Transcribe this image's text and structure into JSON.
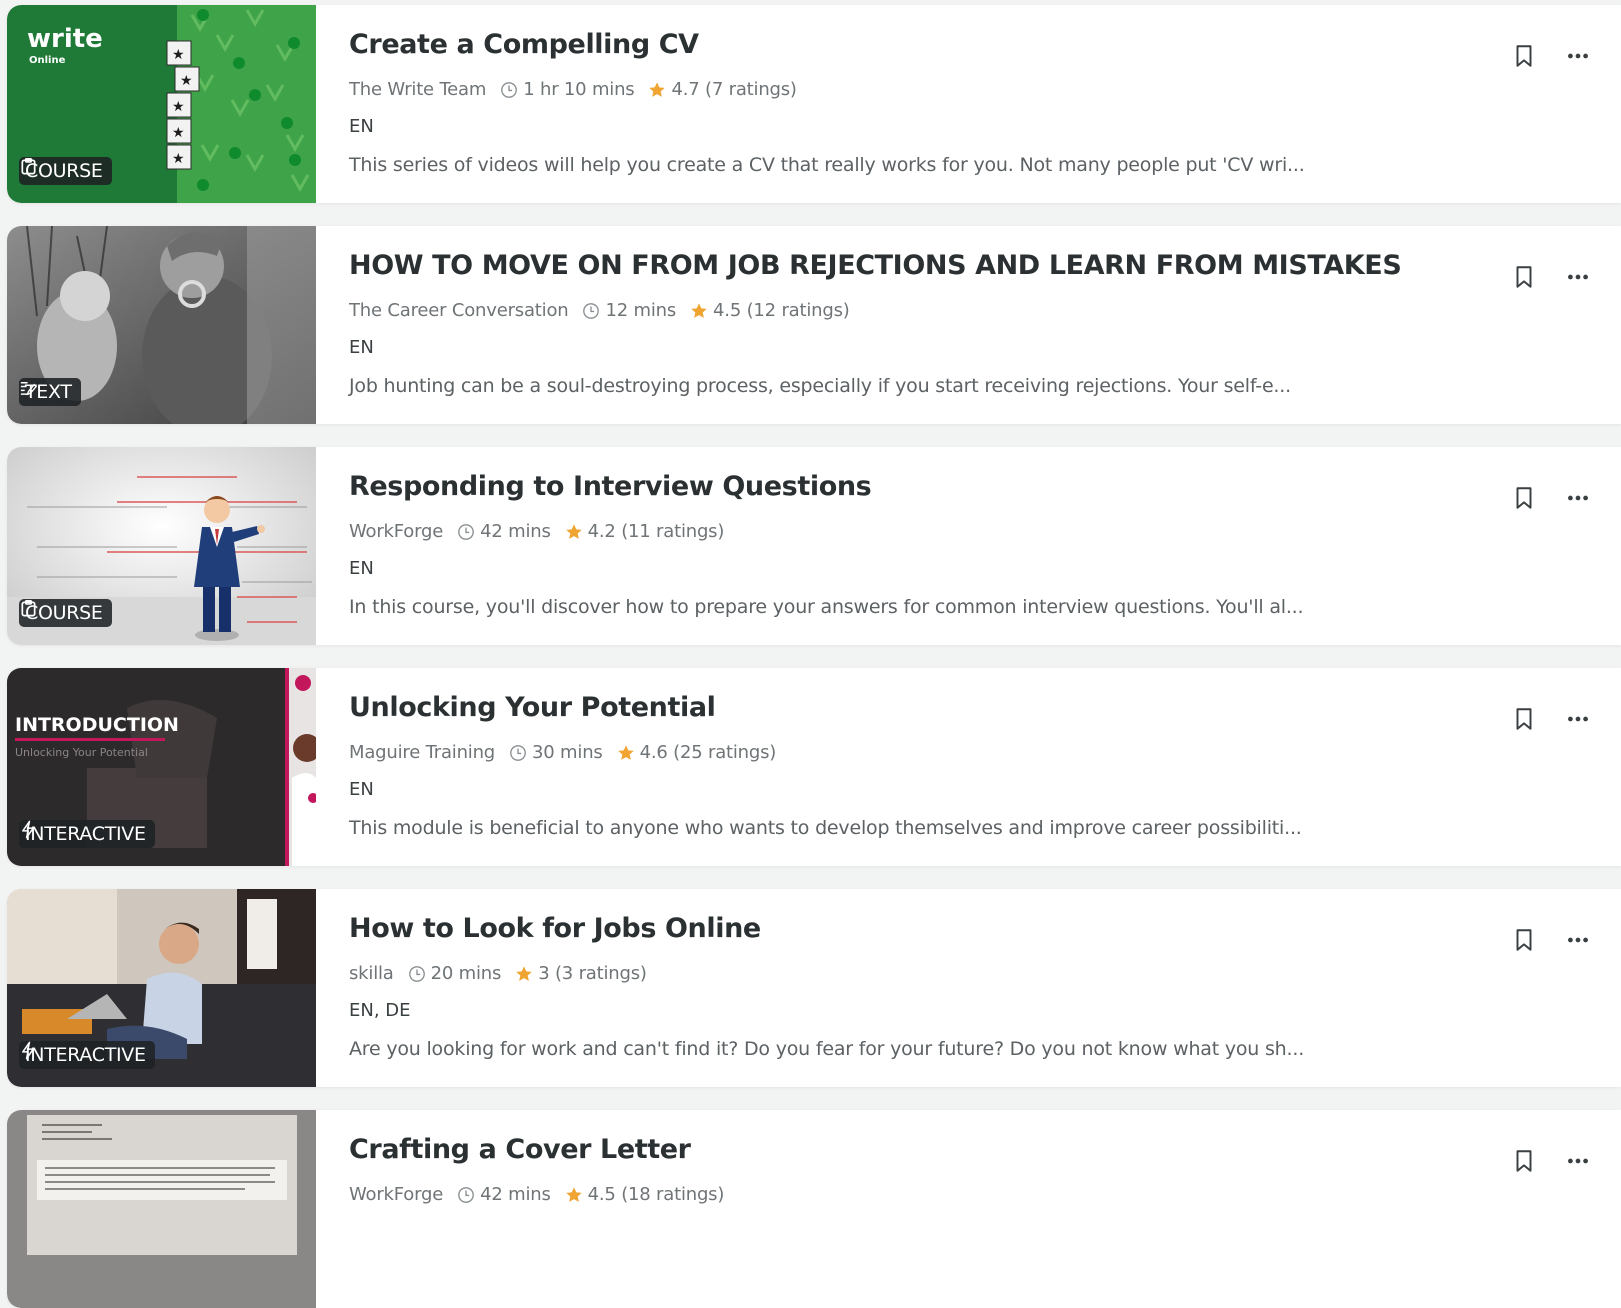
{
  "items": [
    {
      "title": "Create a Compelling CV",
      "provider": "The Write Team",
      "duration": "1 hr 10 mins",
      "rating": "4.7 (7 ratings)",
      "languages": "EN",
      "description": "This series of videos will help you create a CV that really works for you. Not many people put 'CV wri...",
      "type": "COURSE",
      "thumb_logo_main": "write",
      "thumb_logo_sub": "Online"
    },
    {
      "title": "HOW TO MOVE ON FROM JOB REJECTIONS AND LEARN FROM MISTAKES",
      "provider": "The Career Conversation",
      "duration": "12 mins",
      "rating": "4.5 (12 ratings)",
      "languages": "EN",
      "description": "Job hunting can be a soul-destroying process, especially if you start receiving rejections. Your self-e...",
      "type": "TEXT"
    },
    {
      "title": "Responding to Interview Questions",
      "provider": "WorkForge",
      "duration": "42 mins",
      "rating": "4.2 (11 ratings)",
      "languages": "EN",
      "description": "In this course, you'll discover how to prepare your answers for common interview questions. You'll al...",
      "type": "COURSE"
    },
    {
      "title": "Unlocking Your Potential",
      "provider": "Maguire Training",
      "duration": "30 mins",
      "rating": "4.6 (25 ratings)",
      "languages": "EN",
      "description": "This module is beneficial to anyone who wants to develop themselves and improve career possibiliti...",
      "type": "INTERACTIVE",
      "thumb_heading": "INTRODUCTION",
      "thumb_subheading": "Unlocking Your Potential"
    },
    {
      "title": "How to Look for Jobs Online",
      "provider": "skilla",
      "duration": "20 mins",
      "rating": "3 (3 ratings)",
      "languages": "EN, DE",
      "description": "Are you looking for work and can't find it? Do you fear for your future? Do you not know what you sh...",
      "type": "INTERACTIVE"
    },
    {
      "title": "Crafting a Cover Letter",
      "provider": "WorkForge",
      "duration": "42 mins",
      "rating": "4.5 (18 ratings)",
      "languages": "",
      "description": "",
      "type": ""
    }
  ],
  "colors": {
    "star": "#f0a533",
    "text": "#2b3033",
    "muted": "#6f7477",
    "badge_bg": "#1e2224"
  },
  "icons": {
    "bookmark": "bookmark-icon",
    "more": "more-options-icon",
    "clock": "clock-icon",
    "star": "star-icon"
  }
}
